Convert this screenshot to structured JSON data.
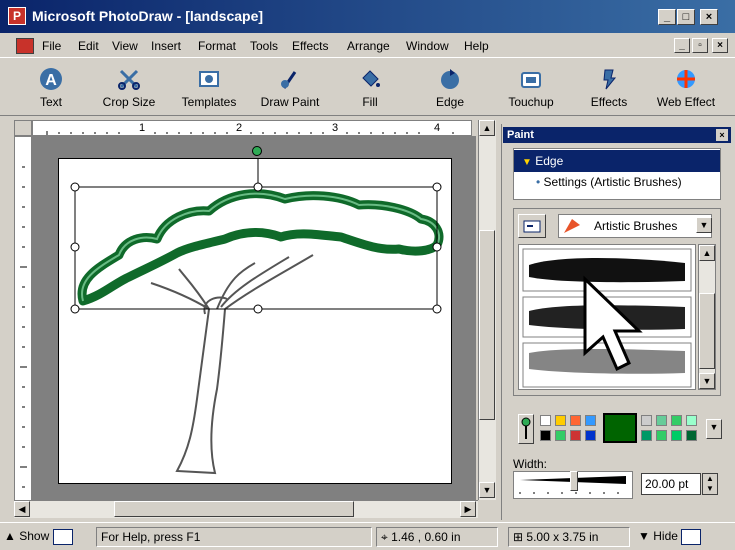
{
  "window": {
    "title": "Microsoft PhotoDraw - [landscape]",
    "controls": [
      "_",
      "□",
      "×"
    ]
  },
  "menu": {
    "items": [
      "File",
      "Edit",
      "View",
      "Insert",
      "Format",
      "Tools",
      "Effects",
      "Arrange",
      "Window",
      "Help"
    ],
    "doc_controls": [
      "_",
      "▫",
      "×"
    ]
  },
  "toolbar": {
    "tools": [
      {
        "label": "Text",
        "icon": "text-icon"
      },
      {
        "label": "Crop Size",
        "icon": "crop-icon"
      },
      {
        "label": "Templates",
        "icon": "templates-icon"
      },
      {
        "label": "Draw Paint",
        "icon": "draw-paint-icon"
      },
      {
        "label": "Fill",
        "icon": "fill-icon"
      },
      {
        "label": "Edge",
        "icon": "edge-icon"
      },
      {
        "label": "Touchup",
        "icon": "touchup-icon"
      },
      {
        "label": "Effects",
        "icon": "effects-icon"
      },
      {
        "label": "Web Effect",
        "icon": "web-effect-icon"
      }
    ]
  },
  "ruler": {
    "marks": [
      "1",
      "2",
      "3",
      "4"
    ]
  },
  "panel": {
    "title": "Paint",
    "close": "×",
    "workflow": {
      "selected": "Edge",
      "sub": "Settings (Artistic Brushes)"
    },
    "brush_dropdown": "Artistic Brushes",
    "width_label": "Width:",
    "width_value": "20.00 pt",
    "colors": {
      "accent": "#0a246a",
      "selected_color": "#006400",
      "swatches_row1": [
        "#ffffff",
        "#ffcc00",
        "#ff6633",
        "#3399ff",
        "#cccccc",
        "#66cc99",
        "#33cc66",
        "#99ffcc"
      ],
      "swatches_row2": [
        "#000000",
        "#33cc66",
        "#cc3333",
        "#0033cc",
        "#009966",
        "#33cc66",
        "#00cc66",
        "#006633"
      ]
    }
  },
  "status": {
    "show": "Show",
    "help": "For Help, press F1",
    "position": "1.46 , 0.60  in",
    "size": "5.00 x 3.75  in",
    "hide": "Hide"
  }
}
